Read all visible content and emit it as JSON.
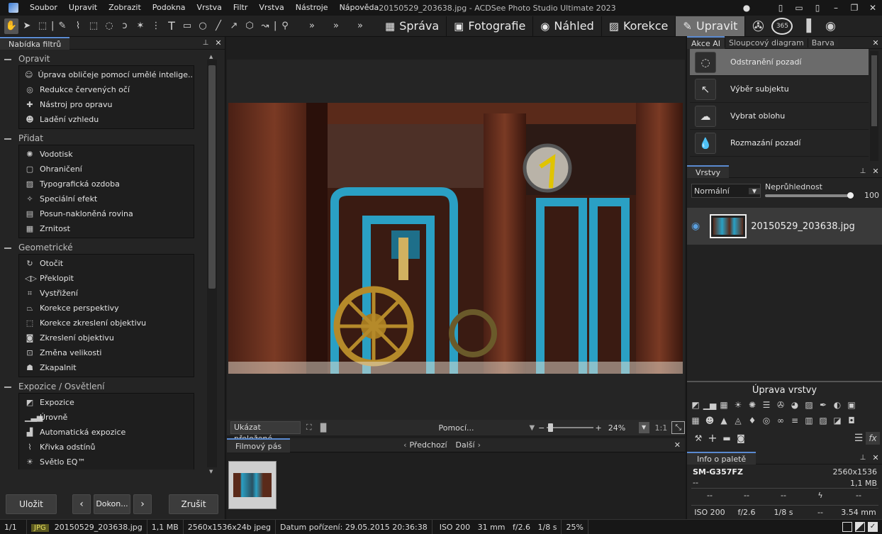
{
  "window": {
    "title": "20150529_203638.jpg - ACDSee Photo Studio Ultimate 2023"
  },
  "menu": [
    "Soubor",
    "Upravit",
    "Zobrazit",
    "Podokna",
    "Vrstva",
    "Filtr",
    "Vrstva",
    "Nástroje",
    "Nápověda"
  ],
  "modes": [
    {
      "label": "Správa",
      "icon": "▦"
    },
    {
      "label": "Fotografie",
      "icon": "▣"
    },
    {
      "label": "Náhled",
      "icon": "◉"
    },
    {
      "label": "Korekce",
      "icon": "▨"
    },
    {
      "label": "Upravit",
      "icon": "✎"
    }
  ],
  "mode_extra": [
    "365"
  ],
  "left_panel": {
    "tab": "Nabídka filtrů",
    "groups": [
      {
        "title": "Opravit",
        "items": [
          "Úprava obličeje pomocí umělé intelige...",
          "Redukce červených očí",
          "Nástroj pro opravu",
          "Ladění vzhledu"
        ]
      },
      {
        "title": "Přidat",
        "items": [
          "Vodotisk",
          "Ohraničení",
          "Typografická ozdoba",
          "Speciální efekt",
          "Posun-nakloněná rovina",
          "Zrnitost"
        ]
      },
      {
        "title": "Geometrické",
        "items": [
          "Otočit",
          "Překlopit",
          "Vystřižení",
          "Korekce perspektivy",
          "Korekce zkreslení objektivu",
          "Zkreslení objektivu",
          "Změna velikosti",
          "Zkapalnit"
        ]
      },
      {
        "title": "Expozice / Osvětlení",
        "items": [
          "Expozice",
          "Úrovně",
          "Automatická expozice",
          "Křivka odstínů",
          "Světlo EQ™"
        ]
      }
    ],
    "buttons": {
      "save": "Uložit",
      "done": "Dokon...",
      "cancel": "Zrušit"
    }
  },
  "viewer": {
    "show_overlay": "Ukázat přeložené",
    "help": "Pomocí...",
    "zoom": "24%",
    "ratio": "1:1"
  },
  "filmstrip": {
    "tab": "Filmový pás",
    "prev": "Předchozí",
    "next": "Další"
  },
  "right_panel": {
    "tabs": [
      "Akce AI",
      "Sloupcový diagram",
      "Barva"
    ],
    "ai_actions": [
      "Odstranění pozadí",
      "Výběr subjektu",
      "Vybrat oblohu",
      "Rozmazání pozadí"
    ],
    "layers": {
      "tab": "Vrstvy",
      "blend": "Normální",
      "opacity_label": "Neprůhlednost",
      "opacity_value": "100",
      "opacity_fraction": 0.97,
      "layer_name": "20150529_203638.jpg"
    },
    "layer_adjust": {
      "title": "Úprava vrstvy"
    },
    "info": {
      "tab": "Info o paletě",
      "camera": "SM-G357FZ",
      "resolution": "2560x1536",
      "dash1": "--",
      "size": "1,1 MB",
      "row1": [
        "--",
        "--",
        "--",
        "ϟ",
        "--"
      ],
      "row2": [
        "ISO 200",
        "f/2.6",
        "1/8 s",
        "--",
        "3.54 mm"
      ]
    }
  },
  "status": {
    "count": "1/1",
    "type": "JPG",
    "file": "20150529_203638.jpg",
    "size": "1,1 MB",
    "dims": "2560x1536x24b jpeg",
    "date": "Datum pořízení: 29.05.2015 20:36:38",
    "exif": "ISO 200   31 mm   f/2.6   1/8 s",
    "zoom": "25%"
  }
}
